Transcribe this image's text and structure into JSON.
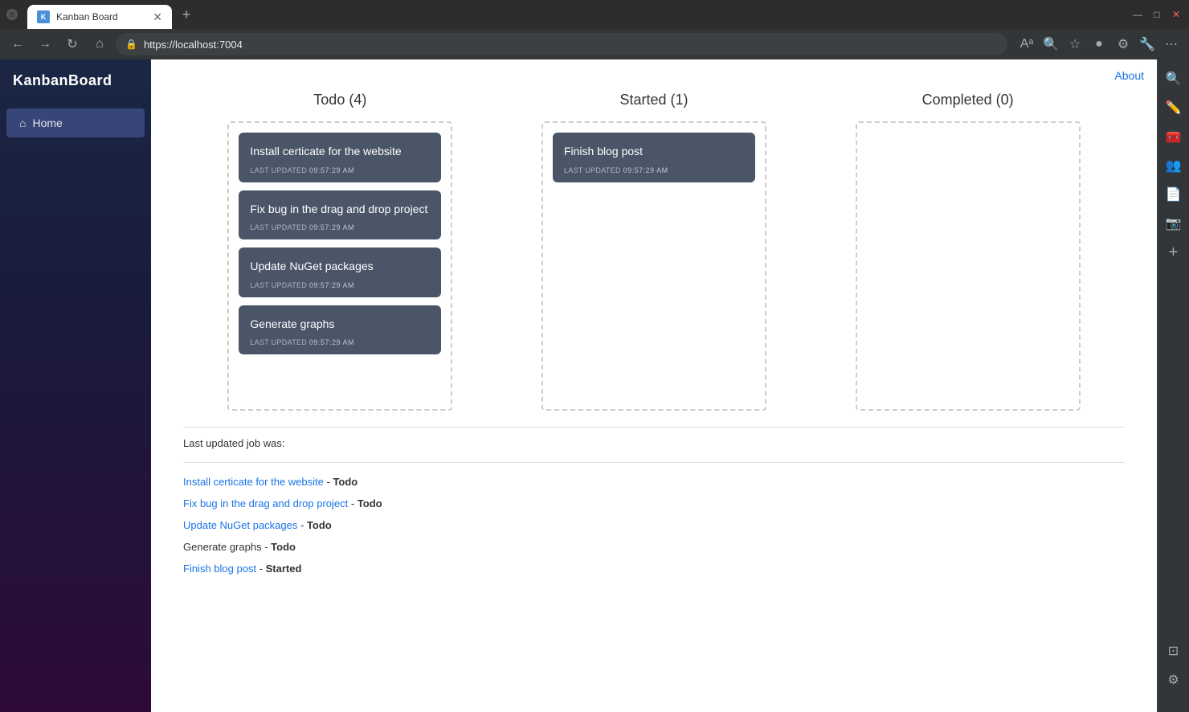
{
  "browser": {
    "tab_title": "Kanban Board",
    "url": "https://localhost:7004",
    "new_tab_label": "+",
    "nav_back": "←",
    "nav_forward": "→",
    "nav_refresh": "↻",
    "nav_home": "⌂",
    "win_minimize": "—",
    "win_maximize": "□",
    "win_close": "✕"
  },
  "app": {
    "logo": "KanbanBoard",
    "about_link": "About"
  },
  "sidebar": {
    "items": [
      {
        "label": "Home",
        "icon": "⌂",
        "active": true
      }
    ]
  },
  "kanban": {
    "columns": [
      {
        "title": "Todo (4)",
        "id": "todo",
        "cards": [
          {
            "title": "Install certicate for the website",
            "timestamp": "09:57:29 AM"
          },
          {
            "title": "Fix bug in the drag and drop project",
            "timestamp": "09:57:29 AM"
          },
          {
            "title": "Update NuGet packages",
            "timestamp": "09:57:29 AM"
          },
          {
            "title": "Generate graphs",
            "timestamp": "09:57:29 AM"
          }
        ]
      },
      {
        "title": "Started (1)",
        "id": "started",
        "cards": [
          {
            "title": "Finish blog post",
            "timestamp": "09:57:29 AM"
          }
        ]
      },
      {
        "title": "Completed (0)",
        "id": "completed",
        "cards": []
      }
    ]
  },
  "footer": {
    "last_updated_label": "Last updated job was:",
    "jobs": [
      {
        "name": "Install certicate for the website",
        "status": "Todo"
      },
      {
        "name": "Fix bug in the drag and drop project",
        "status": "Todo"
      },
      {
        "name": "Update NuGet packages",
        "status": "Todo"
      },
      {
        "name": "Generate graphs",
        "status": "Todo"
      },
      {
        "name": "Finish blog post",
        "status": "Started"
      }
    ]
  },
  "timestamp_label": "LAST UPDATED"
}
